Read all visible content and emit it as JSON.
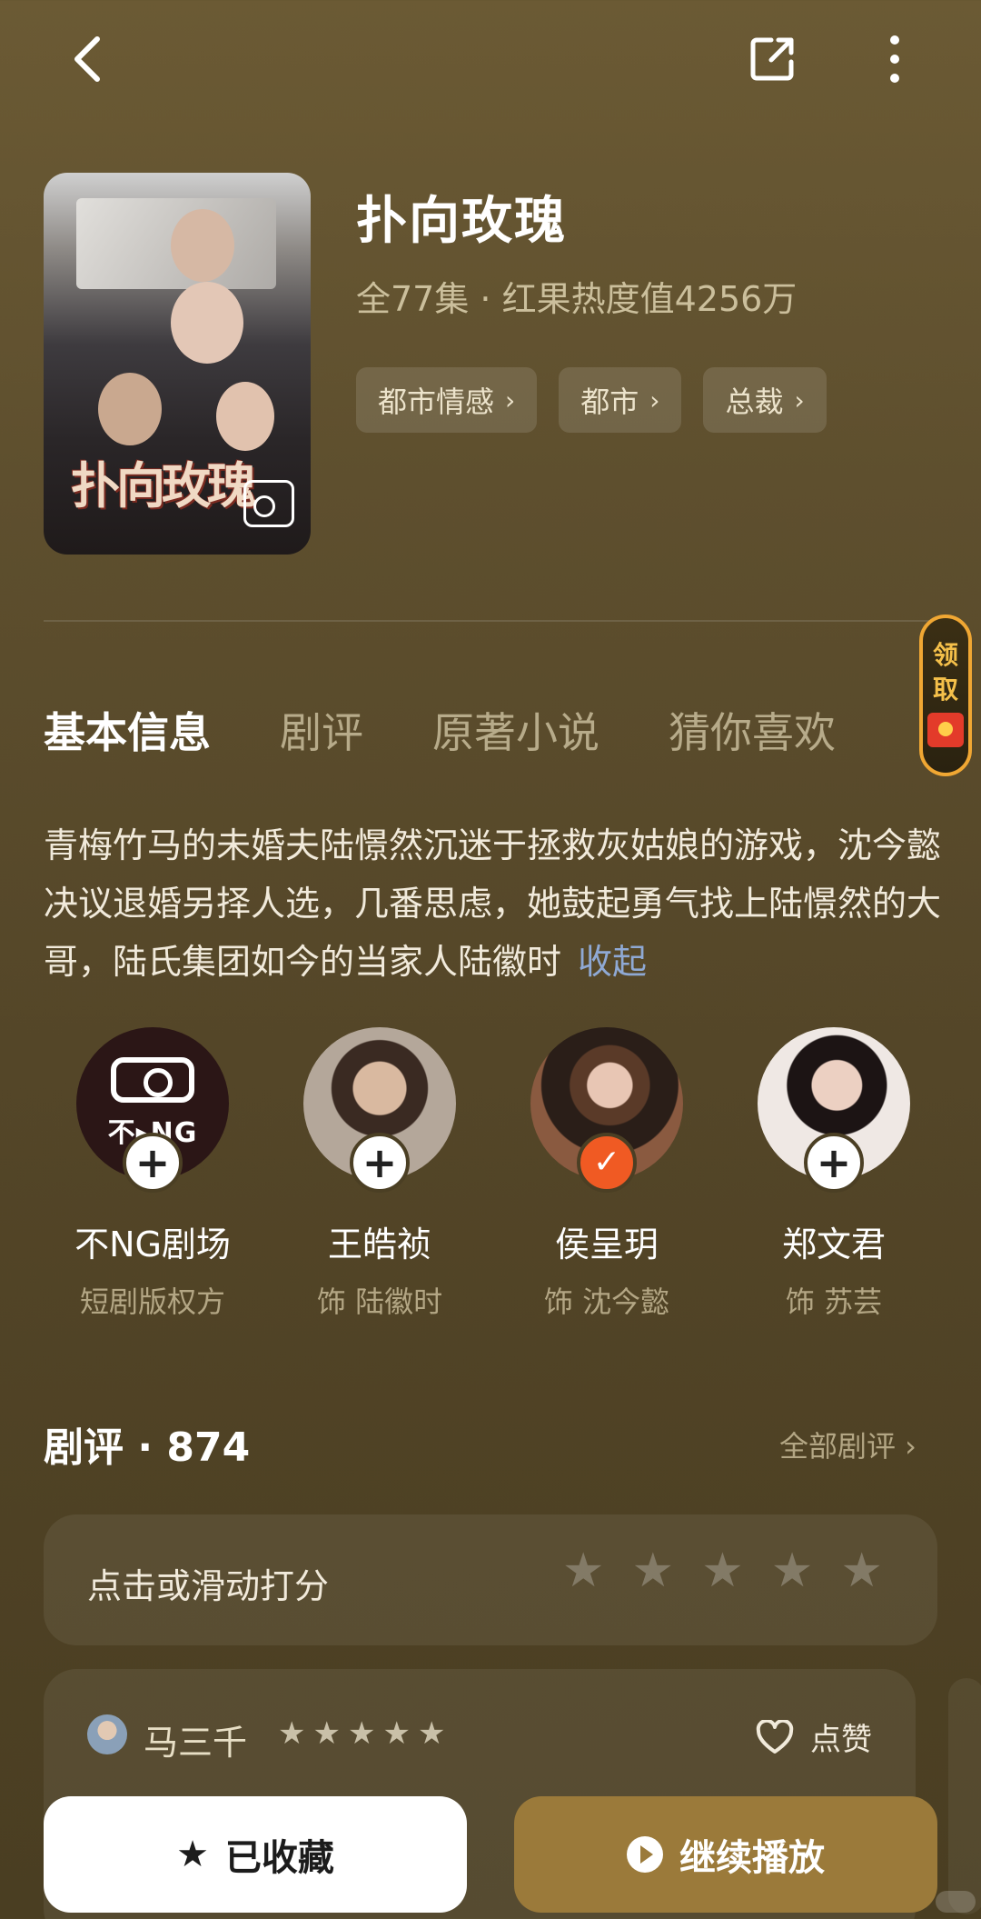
{
  "header": {
    "back_icon": "chevron-left-icon",
    "share_icon": "share-icon",
    "more_icon": "more-vertical-icon"
  },
  "show": {
    "poster_title": "扑向玫瑰",
    "title": "扑向玫瑰",
    "meta": "全77集 · 红果热度值4256万",
    "tags": [
      {
        "label": "都市情感"
      },
      {
        "label": "都市"
      },
      {
        "label": "总裁"
      }
    ]
  },
  "claim": {
    "label": "领取"
  },
  "tabs": [
    {
      "label": "基本信息",
      "active": true
    },
    {
      "label": "剧评",
      "active": false
    },
    {
      "label": "原著小说",
      "active": false
    },
    {
      "label": "猜你喜欢",
      "active": false
    }
  ],
  "synopsis": {
    "text": "青梅竹马的未婚夫陆憬然沉迷于拯救灰姑娘的游戏，沈今懿决议退婚另择人选，几番思虑，她鼓起勇气找上陆憬然的大哥，陆氏集团如今的当家人陆徽时",
    "collapse_label": "收起"
  },
  "cast": [
    {
      "name": "不NG剧场",
      "role": "短剧版权方",
      "logo_text": "不▸NG",
      "followed": false
    },
    {
      "name": "王皓祯",
      "role": "饰 陆徽时",
      "followed": false
    },
    {
      "name": "侯呈玥",
      "role": "饰 沈今懿",
      "followed": true
    },
    {
      "name": "郑文君",
      "role": "饰 苏芸",
      "followed": false
    }
  ],
  "reviews": {
    "title": "剧评 · 874",
    "all_label": "全部剧评 ›",
    "rating_prompt": "点击或滑动打分",
    "rating_stars": 5,
    "first": {
      "author": "马三千",
      "stars": 5,
      "like_label": "点赞"
    }
  },
  "actions": {
    "collect_label": "已收藏",
    "play_label": "继续播放"
  },
  "colors": {
    "accent": "#f05a23",
    "play_button": "#9b7a3a",
    "link": "#8fa9d4"
  }
}
